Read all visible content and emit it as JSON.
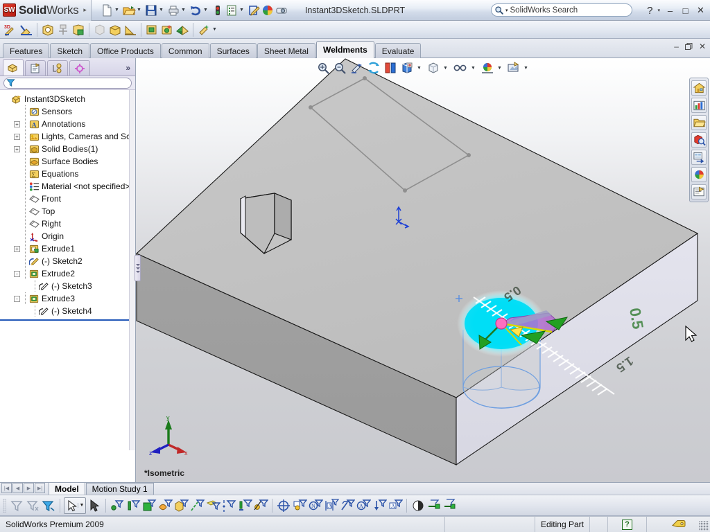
{
  "app": {
    "brand_sw": "SW",
    "brand_bold": "Solid",
    "brand_light": "Works",
    "brand_arrow": "▸",
    "document_title": "Instant3DSketch.SLDPRT",
    "status_product": "SolidWorks Premium 2009"
  },
  "search": {
    "placeholder": "SolidWorks Search",
    "value": "SolidWorks Search",
    "dropdown_caret": "▾",
    "icon": "search-icon"
  },
  "titlebar_buttons": {
    "help": "?",
    "help_caret": "▾",
    "minimize": "–",
    "maximize": "□",
    "close": "✕"
  },
  "doc_window_buttons": {
    "minimize": "–",
    "restore": "🗗",
    "close": "✕"
  },
  "main_toolbar": {
    "items": [
      {
        "name": "new-document-icon",
        "caret": true
      },
      {
        "name": "open-document-icon",
        "caret": true
      },
      {
        "name": "save-document-icon",
        "caret": true
      },
      {
        "name": "print-document-icon",
        "caret": true
      },
      {
        "name": "undo-icon",
        "caret": true
      },
      {
        "name": "rebuild-icon",
        "caret": false
      },
      {
        "name": "options-icon",
        "caret": true
      },
      {
        "name": "edit-appearance-icon",
        "caret": false
      },
      {
        "name": "color-sphere-icon",
        "caret": false
      },
      {
        "name": "measure-icon",
        "caret": false
      }
    ]
  },
  "weldments_toolbar": {
    "items": [
      {
        "name": "3d-sketch-icon"
      },
      {
        "name": "structural-member-icon"
      },
      {
        "name": "trim-extend-icon"
      },
      {
        "name": "end-cap-icon"
      },
      {
        "name": "gusset-icon"
      },
      {
        "name": "fillet-bead-icon"
      },
      {
        "name": "weld-bead-icon"
      },
      {
        "name": "chamfer-icon"
      },
      {
        "name": "extruded-boss-icon"
      },
      {
        "name": "extruded-cut-icon"
      },
      {
        "name": "weldment-icon"
      },
      {
        "name": "cut-list-icon"
      },
      {
        "name": "weldment-more-caret"
      }
    ]
  },
  "command_tabs": {
    "active": "Weldments",
    "items": [
      {
        "label": "Features"
      },
      {
        "label": "Sketch"
      },
      {
        "label": "Office Products"
      },
      {
        "label": "Common"
      },
      {
        "label": "Surfaces"
      },
      {
        "label": "Sheet Metal"
      },
      {
        "label": "Weldments"
      },
      {
        "label": "Evaluate"
      }
    ]
  },
  "tree_panel": {
    "tabs": [
      {
        "name": "feature-manager-tab",
        "icon": "feature-tree-icon",
        "active": true
      },
      {
        "name": "property-manager-tab",
        "icon": "property-page-icon",
        "active": false
      },
      {
        "name": "configuration-manager-tab",
        "icon": "configuration-icon",
        "active": false
      },
      {
        "name": "dimxpert-manager-tab",
        "icon": "dimxpert-target-icon",
        "active": false
      }
    ],
    "overflow_chevron": "»",
    "filter_placeholder": "",
    "filter_value": "",
    "filter_icon": "filter-funnel-icon",
    "items": [
      {
        "label": "Instant3DSketch",
        "icon": "part-icon",
        "indent": 0,
        "expander": "none"
      },
      {
        "label": "Sensors",
        "icon": "sensors-icon",
        "indent": 1,
        "expander": "none"
      },
      {
        "label": "Annotations",
        "icon": "annotations-icon",
        "indent": 1,
        "expander": "+"
      },
      {
        "label": "Lights, Cameras and Scene",
        "icon": "lights-cameras-icon",
        "indent": 1,
        "expander": "+"
      },
      {
        "label": "Solid Bodies(1)",
        "icon": "solid-bodies-icon",
        "indent": 1,
        "expander": "+"
      },
      {
        "label": "Surface Bodies",
        "icon": "surface-bodies-icon",
        "indent": 1,
        "expander": "none"
      },
      {
        "label": "Equations",
        "icon": "equations-icon",
        "indent": 1,
        "expander": "none"
      },
      {
        "label": "Material <not specified>",
        "icon": "material-icon",
        "indent": 1,
        "expander": "none"
      },
      {
        "label": "Front",
        "icon": "plane-icon",
        "indent": 1,
        "expander": "none"
      },
      {
        "label": "Top",
        "icon": "plane-icon",
        "indent": 1,
        "expander": "none"
      },
      {
        "label": "Right",
        "icon": "plane-icon",
        "indent": 1,
        "expander": "none"
      },
      {
        "label": "Origin",
        "icon": "origin-icon",
        "indent": 1,
        "expander": "none"
      },
      {
        "label": "Extrude1",
        "icon": "extrude-boss-icon",
        "indent": 1,
        "expander": "+"
      },
      {
        "label": "(-) Sketch2",
        "icon": "sketch-pencil-icon",
        "indent": 1,
        "expander": "none"
      },
      {
        "label": "Extrude2",
        "icon": "extrude-cut-icon",
        "indent": 1,
        "expander": "-"
      },
      {
        "label": "(-) Sketch3",
        "icon": "sketch-icon",
        "indent": 2,
        "expander": "none"
      },
      {
        "label": "Extrude3",
        "icon": "extrude-cut-icon",
        "indent": 1,
        "expander": "-"
      },
      {
        "label": "(-) Sketch4",
        "icon": "sketch-icon",
        "indent": 2,
        "expander": "none"
      }
    ]
  },
  "view_toolbar": {
    "items": [
      {
        "name": "zoom-to-fit-icon",
        "caret": false
      },
      {
        "name": "zoom-to-area-icon",
        "caret": false
      },
      {
        "name": "previous-view-icon",
        "caret": false
      },
      {
        "name": "section-view-icon",
        "caret": false
      },
      {
        "name": "view-orientation-icon",
        "caret": false
      },
      {
        "name": "display-style-icon",
        "caret": true
      },
      {
        "name": "hide-show-items-icon",
        "caret": true
      },
      {
        "name": "edit-appearance-icon",
        "caret": true
      },
      {
        "name": "apply-scene-icon",
        "caret": true
      },
      {
        "name": "view-settings-icon",
        "caret": true
      }
    ]
  },
  "task_pane": {
    "items": [
      {
        "name": "solidworks-resources-tab",
        "icon": "home-icon"
      },
      {
        "name": "design-library-tab",
        "icon": "library-chart-icon"
      },
      {
        "name": "file-explorer-tab",
        "icon": "folder-icon"
      },
      {
        "name": "search-tab",
        "icon": "search-3d-icon"
      },
      {
        "name": "view-palette-tab",
        "icon": "view-palette-icon"
      },
      {
        "name": "appearances-scenes-tab",
        "icon": "color-sphere-icon"
      },
      {
        "name": "custom-properties-tab",
        "icon": "custom-properties-icon"
      }
    ]
  },
  "graphics": {
    "view_label": "*Isometric",
    "triad": {
      "x": "x",
      "y": "y",
      "z": "z"
    },
    "instant3d_ruler": {
      "labels": [
        "0.5",
        "0.5",
        "1.5"
      ],
      "handle_color": "#00e5ff",
      "arrow_color": "#00a000",
      "drag_point_color": "#ff69b4"
    }
  },
  "bottom_tabs": {
    "nav": [
      "|◀",
      "◀",
      "▶",
      "▶|"
    ],
    "active": "Model",
    "items": [
      {
        "label": "Model"
      },
      {
        "label": "Motion Study 1"
      }
    ]
  },
  "selection_filter_toolbar": {
    "items": [
      {
        "name": "filter-off-icon"
      },
      {
        "name": "clear-filters-icon"
      },
      {
        "name": "toggle-filters-icon"
      },
      {
        "name": "select-arrow-icon",
        "caret": true
      },
      {
        "name": "select-other-icon"
      },
      {
        "name": "filter-vertices-icon"
      },
      {
        "name": "filter-edges-icon"
      },
      {
        "name": "filter-faces-icon"
      },
      {
        "name": "filter-surface-bodies-icon"
      },
      {
        "name": "filter-solid-bodies-icon"
      },
      {
        "name": "filter-axes-icon"
      },
      {
        "name": "filter-planes-icon"
      },
      {
        "name": "filter-sketch-points-icon"
      },
      {
        "name": "filter-sketch-segments-icon"
      },
      {
        "name": "filter-midpoints-icon"
      },
      {
        "name": "filter-center-marks-icon"
      },
      {
        "name": "filter-centerlines-icon"
      },
      {
        "name": "filter-dimensions-icon"
      },
      {
        "name": "filter-surface-finish-icon"
      },
      {
        "name": "filter-blocks-icon"
      },
      {
        "name": "filter-notes-icon"
      },
      {
        "name": "filter-balloons-icon"
      },
      {
        "name": "filter-datums-icon"
      },
      {
        "name": "filter-weld-symbols-icon"
      },
      {
        "name": "filter-annotations-icon"
      },
      {
        "name": "filter-shading-icon"
      },
      {
        "name": "filter-connection-points-icon"
      },
      {
        "name": "filter-routing-points-icon"
      }
    ]
  },
  "status_bar": {
    "editing_state": "Editing Part",
    "help_indicator": "?",
    "tag_icon": "tag-icon"
  }
}
